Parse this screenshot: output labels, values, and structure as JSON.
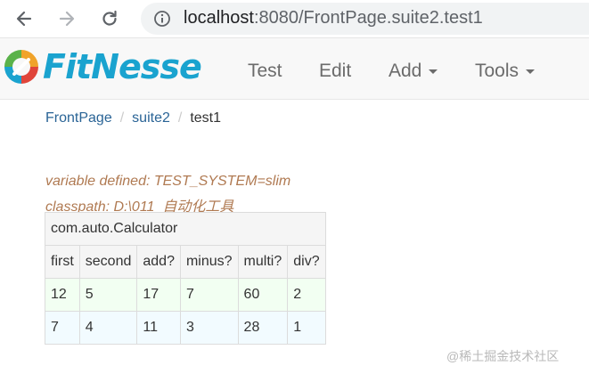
{
  "browser": {
    "url": "localhost:8080/FrontPage.suite2.test1",
    "url_host": "localhost",
    "url_rest": ":8080/FrontPage.suite2.test1"
  },
  "header": {
    "logo_text": "FitNesse",
    "menu": {
      "test": "Test",
      "edit": "Edit",
      "add": "Add",
      "tools": "Tools"
    }
  },
  "breadcrumb": {
    "items": [
      "FrontPage",
      "suite2"
    ],
    "separator": "/",
    "current": "test1"
  },
  "variables": {
    "line1": "variable defined: TEST_SYSTEM=slim",
    "line2": "classpath: D:\\011_自动化工具"
  },
  "table": {
    "title": "com.auto.Calculator",
    "headers": [
      "first",
      "second",
      "add?",
      "minus?",
      "multi?",
      "div?"
    ],
    "rows": [
      [
        "12",
        "5",
        "17",
        "7",
        "60",
        "2"
      ],
      [
        "7",
        "4",
        "11",
        "3",
        "28",
        "1"
      ]
    ]
  },
  "watermark": "@稀土掘金技术社区",
  "colors": {
    "brand": "#1aa3cf",
    "link": "#2a6496",
    "variable_text": "#b07a52",
    "pass_row": "#f2fff2",
    "row_alt": "#f2fbff"
  }
}
